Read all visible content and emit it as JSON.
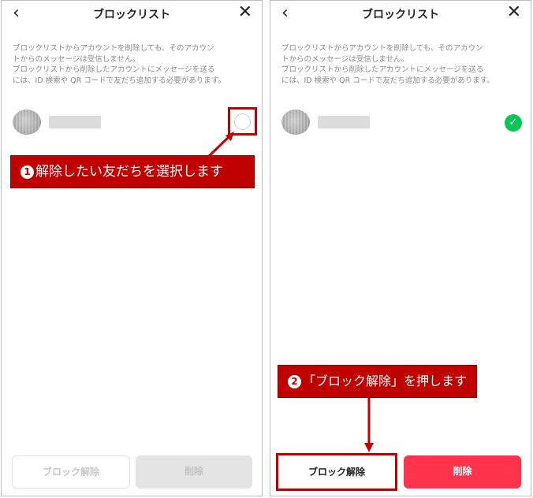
{
  "header": {
    "title": "ブロックリスト",
    "back_icon": "‹",
    "close_icon": "✕"
  },
  "description": {
    "line1": "ブロックリストからアカウントを削除しても、そのアカウン",
    "line2": "トからのメッセージは受信しません。",
    "line3": "ブロックリストから削除したアカウントにメッセージを送る",
    "line4": "には、ID 検索や QR コードで友だち追加する必要があります。"
  },
  "buttons": {
    "unblock_label": "ブロック解除",
    "delete_label": "削除"
  },
  "annotations": {
    "step1_number": "1",
    "step1_text": "解除したい友だちを選択します",
    "step2_number": "2",
    "step2_text": "「ブロック解除」を押します"
  },
  "colors": {
    "annotation_red": "#c00000",
    "check_green": "#06c755",
    "delete_red": "#ff334b"
  },
  "icons": {
    "check": "✓"
  }
}
